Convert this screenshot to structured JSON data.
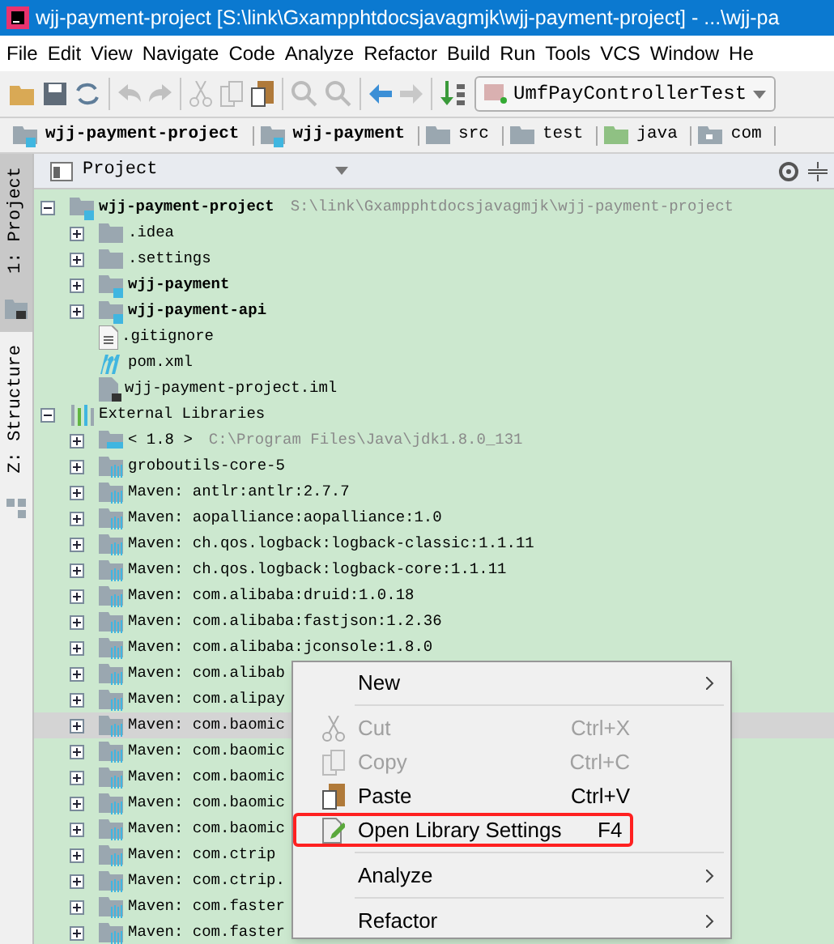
{
  "window": {
    "title": "wjj-payment-project [S:\\link\\Gxampphtdocsjavagmjk\\wjj-payment-project] - ...\\wjj-pa"
  },
  "menu_bar": [
    "File",
    "Edit",
    "View",
    "Navigate",
    "Code",
    "Analyze",
    "Refactor",
    "Build",
    "Run",
    "Tools",
    "VCS",
    "Window",
    "He"
  ],
  "toolbar": {
    "run_config": "UmfPayControllerTest"
  },
  "breadcrumbs": [
    {
      "label": "wjj-payment-project",
      "kind": "module"
    },
    {
      "label": "wjj-payment",
      "kind": "module"
    },
    {
      "label": "src",
      "kind": "folder"
    },
    {
      "label": "test",
      "kind": "folder"
    },
    {
      "label": "java",
      "kind": "source"
    },
    {
      "label": "com",
      "kind": "package"
    }
  ],
  "side_tabs": [
    {
      "label": "1: Project",
      "selected": true
    },
    {
      "label": "Z: Structure",
      "selected": false
    }
  ],
  "project_panel": {
    "title": "Project",
    "tree": [
      {
        "label": "wjj-payment-project",
        "path": "S:\\link\\Gxampphtdocsjavagmjk\\wjj-payment-project",
        "kind": "module",
        "bold": true,
        "expanded": true,
        "children": [
          {
            "label": ".idea",
            "kind": "folder",
            "expanded": false
          },
          {
            "label": ".settings",
            "kind": "folder",
            "expanded": false
          },
          {
            "label": "wjj-payment",
            "kind": "module",
            "bold": true,
            "expanded": false
          },
          {
            "label": "wjj-payment-api",
            "kind": "module",
            "bold": true,
            "expanded": false
          },
          {
            "label": ".gitignore",
            "kind": "file"
          },
          {
            "label": "pom.xml",
            "kind": "maven"
          },
          {
            "label": "wjj-payment-project.iml",
            "kind": "iml"
          }
        ]
      },
      {
        "label": "External Libraries",
        "kind": "libraries",
        "expanded": true,
        "children": [
          {
            "label": "< 1.8 >",
            "path": "C:\\Program Files\\Java\\jdk1.8.0_131",
            "kind": "jdk",
            "expanded": false
          },
          {
            "label": "groboutils-core-5",
            "kind": "library",
            "expanded": false
          },
          {
            "label": "Maven: antlr:antlr:2.7.7",
            "kind": "library",
            "expanded": false
          },
          {
            "label": "Maven: aopalliance:aopalliance:1.0",
            "kind": "library",
            "expanded": false
          },
          {
            "label": "Maven: ch.qos.logback:logback-classic:1.1.11",
            "kind": "library",
            "expanded": false
          },
          {
            "label": "Maven: ch.qos.logback:logback-core:1.1.11",
            "kind": "library",
            "expanded": false
          },
          {
            "label": "Maven: com.alibaba:druid:1.0.18",
            "kind": "library",
            "expanded": false
          },
          {
            "label": "Maven: com.alibaba:fastjson:1.2.36",
            "kind": "library",
            "expanded": false
          },
          {
            "label": "Maven: com.alibaba:jconsole:1.8.0",
            "kind": "library",
            "expanded": false
          },
          {
            "label": "Maven: com.alibab",
            "kind": "library",
            "expanded": false
          },
          {
            "label": "Maven: com.alipay",
            "kind": "library",
            "expanded": false
          },
          {
            "label": "Maven: com.baomic",
            "kind": "library",
            "expanded": false,
            "selected": true
          },
          {
            "label": "Maven: com.baomic",
            "kind": "library",
            "expanded": false
          },
          {
            "label": "Maven: com.baomic",
            "kind": "library",
            "expanded": false
          },
          {
            "label": "Maven: com.baomic",
            "kind": "library",
            "expanded": false
          },
          {
            "label": "Maven: com.baomic",
            "kind": "library",
            "expanded": false
          },
          {
            "label": "Maven: com.ctrip",
            "kind": "library",
            "expanded": false
          },
          {
            "label": "Maven: com.ctrip.",
            "kind": "library",
            "expanded": false
          },
          {
            "label": "Maven: com.faster",
            "kind": "library",
            "expanded": false
          },
          {
            "label": "Maven: com.faster",
            "kind": "library",
            "expanded": false
          }
        ]
      }
    ]
  },
  "context_menu": [
    {
      "kind": "item",
      "label": "New",
      "submenu": true
    },
    {
      "kind": "separator"
    },
    {
      "kind": "item",
      "label": "Cut",
      "shortcut": "Ctrl+X",
      "disabled": true
    },
    {
      "kind": "item",
      "label": "Copy",
      "shortcut": "Ctrl+C",
      "disabled": true
    },
    {
      "kind": "item",
      "label": "Paste",
      "shortcut": "Ctrl+V",
      "disabled": false
    },
    {
      "kind": "item",
      "label": "Open Library Settings",
      "shortcut": "F4",
      "disabled": false,
      "annotated": true
    },
    {
      "kind": "separator"
    },
    {
      "kind": "item",
      "label": "Analyze",
      "submenu": true
    },
    {
      "kind": "separator"
    },
    {
      "kind": "item",
      "label": "Refactor",
      "submenu": true
    }
  ]
}
